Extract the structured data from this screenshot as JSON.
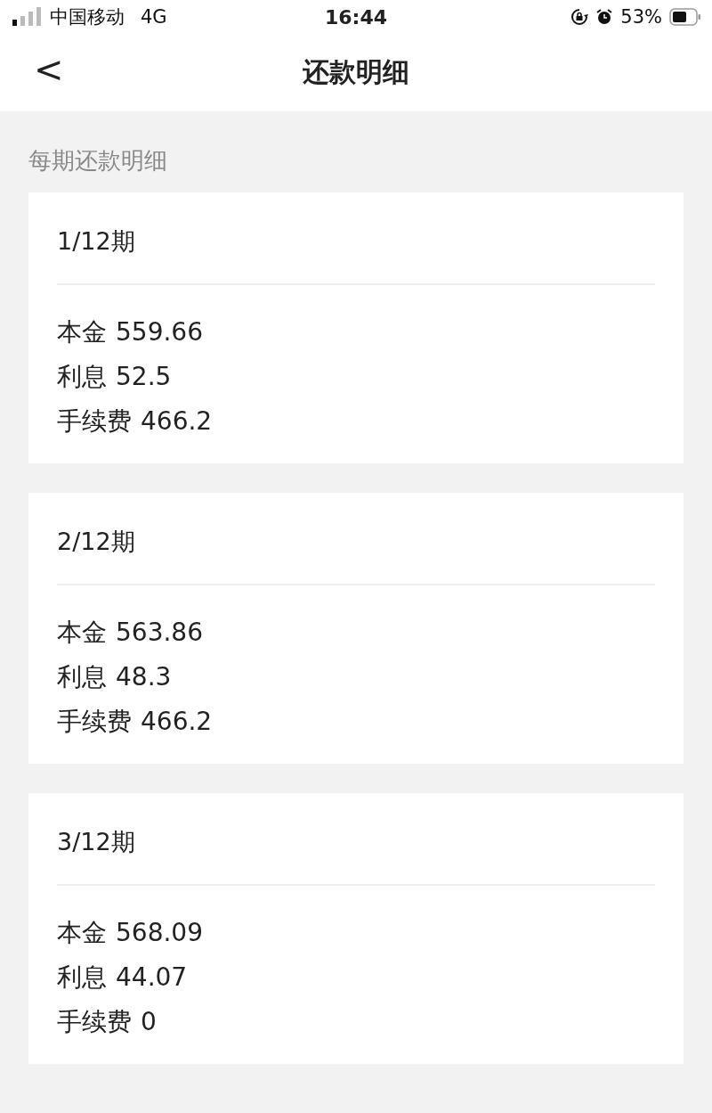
{
  "status_bar": {
    "carrier": "中国移动",
    "network": "4G",
    "time": "16:44",
    "battery": "53%"
  },
  "nav": {
    "back": "<",
    "title": "还款明细"
  },
  "section_label": "每期还款明细",
  "periods": [
    {
      "title": "1/12期",
      "lines": [
        {
          "label": "本金",
          "value": "559.66"
        },
        {
          "label": "利息",
          "value": "52.5"
        },
        {
          "label": "手续费",
          "value": "466.2"
        }
      ]
    },
    {
      "title": "2/12期",
      "lines": [
        {
          "label": "本金",
          "value": "563.86"
        },
        {
          "label": "利息",
          "value": "48.3"
        },
        {
          "label": "手续费",
          "value": "466.2"
        }
      ]
    },
    {
      "title": "3/12期",
      "lines": [
        {
          "label": "本金",
          "value": "568.09"
        },
        {
          "label": "利息",
          "value": "44.07"
        },
        {
          "label": "手续费",
          "value": "0"
        }
      ]
    }
  ]
}
